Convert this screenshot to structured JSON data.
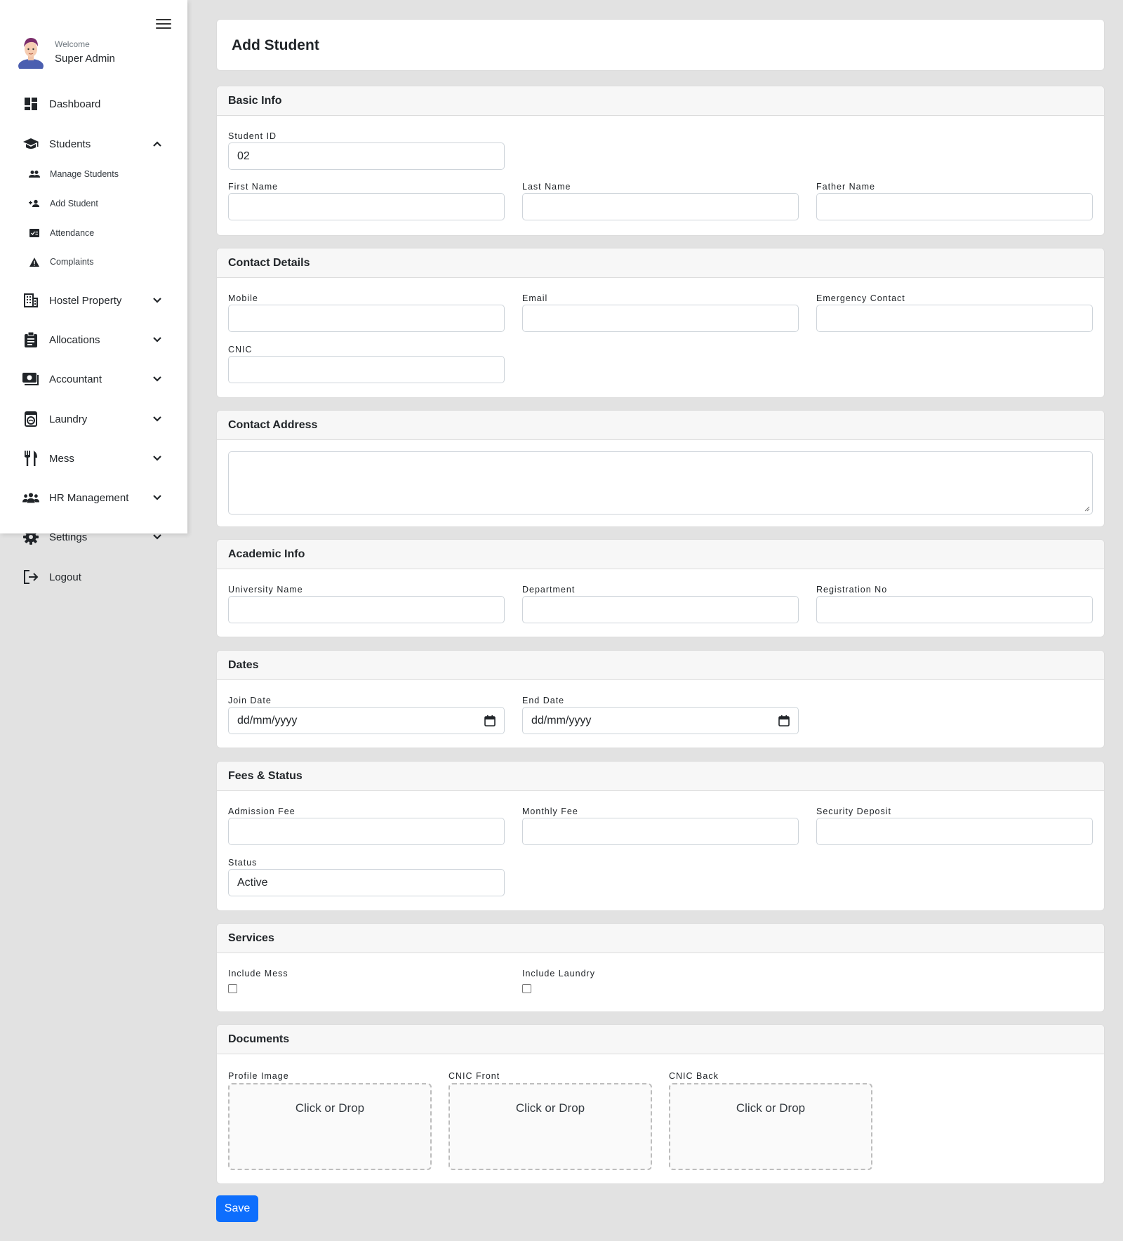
{
  "sidebar": {
    "welcome": "Welcome",
    "user": "Super Admin",
    "items": [
      {
        "label": "Dashboard",
        "icon": "dashboard-icon"
      },
      {
        "label": "Students",
        "icon": "graduation-cap-icon"
      },
      {
        "label": "Hostel Property",
        "icon": "building-icon"
      },
      {
        "label": "Allocations",
        "icon": "clipboard-icon"
      },
      {
        "label": "Accountant",
        "icon": "money-icon"
      },
      {
        "label": "Laundry",
        "icon": "washing-machine-icon"
      },
      {
        "label": "Mess",
        "icon": "utensils-icon"
      },
      {
        "label": "HR Management",
        "icon": "users-icon"
      },
      {
        "label": "Settings",
        "icon": "gear-icon"
      },
      {
        "label": "Logout",
        "icon": "logout-icon"
      }
    ],
    "students_sub": [
      {
        "label": "Manage Students",
        "icon": "people-icon"
      },
      {
        "label": "Add Student",
        "icon": "person-add-icon"
      },
      {
        "label": "Attendance",
        "icon": "attendance-icon"
      },
      {
        "label": "Complaints",
        "icon": "warning-icon"
      }
    ]
  },
  "page_title": "Add Student",
  "sections": {
    "basic": {
      "title": "Basic Info",
      "student_id": {
        "label": "Student ID",
        "value": "02"
      },
      "first_name": {
        "label": "First Name",
        "value": ""
      },
      "last_name": {
        "label": "Last Name",
        "value": ""
      },
      "father_name": {
        "label": "Father Name",
        "value": ""
      }
    },
    "contact": {
      "title": "Contact Details",
      "mobile": {
        "label": "Mobile",
        "value": ""
      },
      "email": {
        "label": "Email",
        "value": ""
      },
      "emergency": {
        "label": "Emergency Contact",
        "value": ""
      },
      "cnic": {
        "label": "CNIC",
        "value": ""
      }
    },
    "address": {
      "title": "Contact Address",
      "value": ""
    },
    "academic": {
      "title": "Academic Info",
      "university": {
        "label": "University Name",
        "value": ""
      },
      "department": {
        "label": "Department",
        "value": ""
      },
      "registration": {
        "label": "Registration No",
        "value": ""
      }
    },
    "dates": {
      "title": "Dates",
      "join": {
        "label": "Join Date",
        "value": "dd/mm/yyyy"
      },
      "end": {
        "label": "End Date",
        "value": "dd/mm/yyyy"
      }
    },
    "fees": {
      "title": "Fees & Status",
      "admission": {
        "label": "Admission Fee",
        "value": ""
      },
      "monthly": {
        "label": "Monthly Fee",
        "value": ""
      },
      "deposit": {
        "label": "Security Deposit",
        "value": ""
      },
      "status": {
        "label": "Status",
        "value": "Active"
      }
    },
    "services": {
      "title": "Services",
      "mess": {
        "label": "Include Mess",
        "checked": false
      },
      "laundry": {
        "label": "Include Laundry",
        "checked": false
      }
    },
    "documents": {
      "title": "Documents",
      "profile": {
        "label": "Profile Image",
        "text": "Click or Drop"
      },
      "cnic_front": {
        "label": "CNIC Front",
        "text": "Click or Drop"
      },
      "cnic_back": {
        "label": "CNIC Back",
        "text": "Click or Drop"
      }
    }
  },
  "save_label": "Save",
  "colors": {
    "primary": "#0d6efd",
    "background": "#e2e2e2",
    "card_header": "#f7f7f7"
  }
}
